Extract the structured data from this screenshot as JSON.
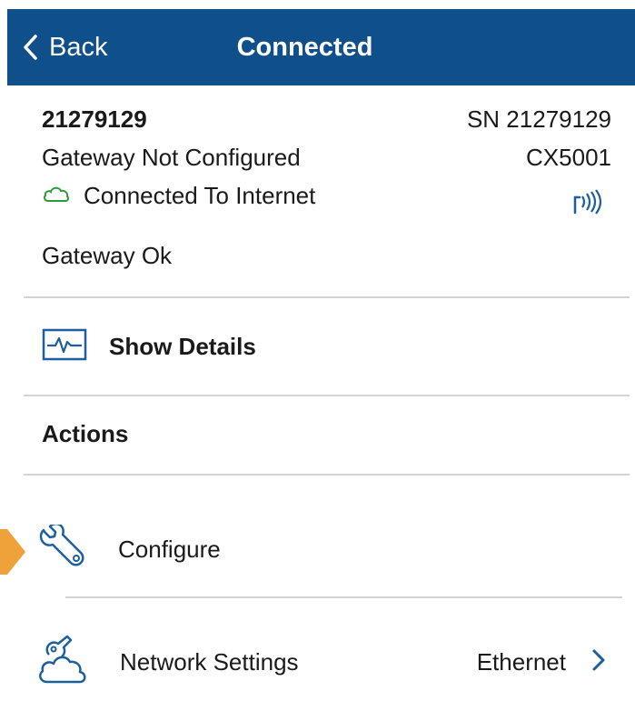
{
  "header": {
    "back_label": "Back",
    "title": "Connected"
  },
  "device": {
    "id": "21279129",
    "serial": "SN 21279129",
    "status": "Gateway Not Configured",
    "model": "CX5001",
    "internet_status": "Connected To Internet",
    "gateway_status": "Gateway Ok"
  },
  "details": {
    "label": "Show Details"
  },
  "actions": {
    "heading": "Actions",
    "items": [
      {
        "label": "Configure",
        "icon": "wrench-icon"
      },
      {
        "label": "Network Settings",
        "value": "Ethernet",
        "icon": "network-cloud-icon"
      }
    ]
  },
  "colors": {
    "header_bg": "#0f4f8a",
    "accent_blue": "#1d5f9e",
    "cloud_green": "#2e9a3a",
    "callout_orange": "#f0a23a"
  }
}
